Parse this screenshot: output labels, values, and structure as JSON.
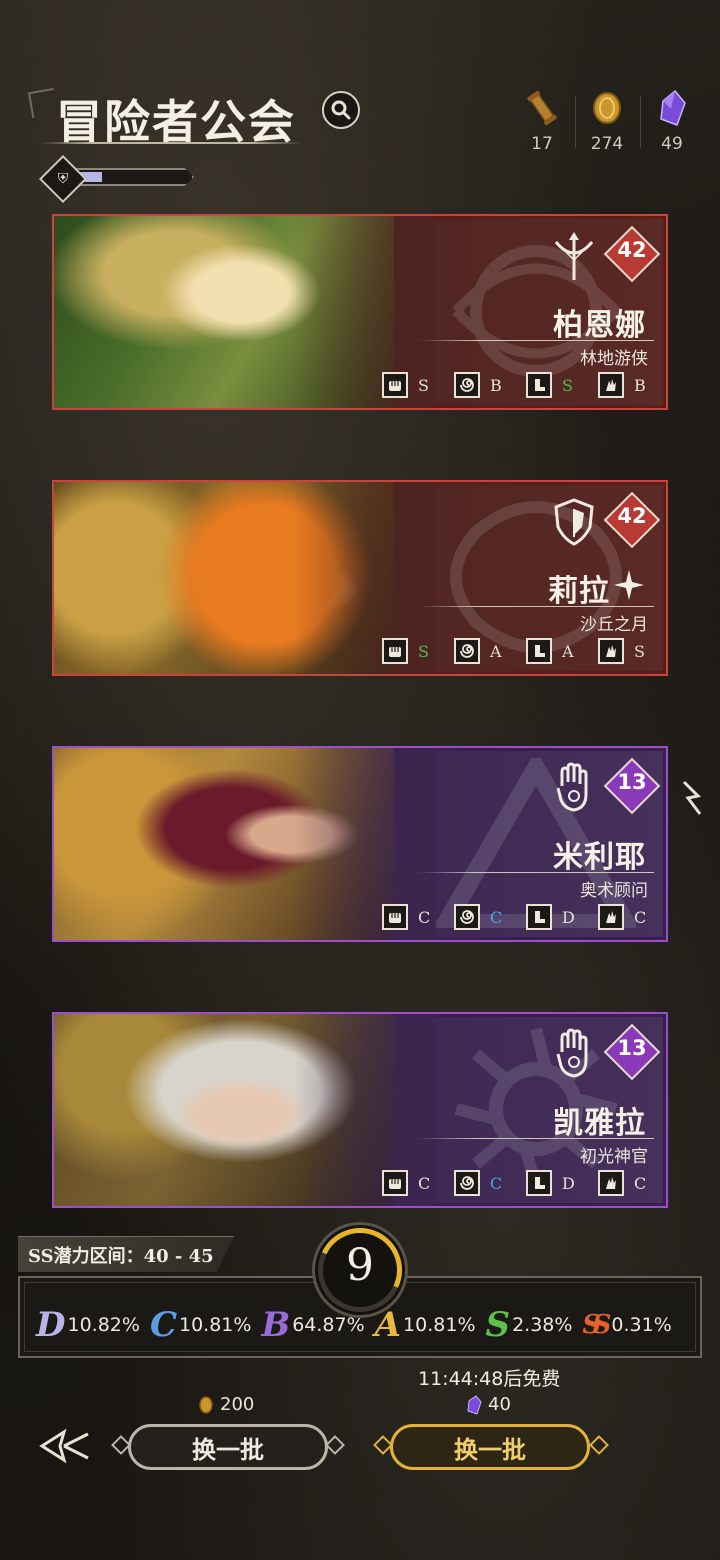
{
  "header": {
    "title": "冒险者公会",
    "level_progress": 0.2
  },
  "currencies": [
    {
      "icon": "scroll-icon",
      "value": "17"
    },
    {
      "icon": "gold-coin-icon",
      "value": "274"
    },
    {
      "icon": "purple-crystal-icon",
      "value": "49"
    }
  ],
  "cards": [
    {
      "name": "柏恩娜",
      "subtitle": "林地游侠",
      "level": "42",
      "rarity": "red",
      "class_icon": "bow-icon",
      "stats": [
        {
          "icon": "fist-icon",
          "grade": "S",
          "color": "#e8e2d4"
        },
        {
          "icon": "vortex-icon",
          "grade": "B",
          "color": "#e8e2d4"
        },
        {
          "icon": "boot-icon",
          "grade": "S",
          "color": "#4fc04a"
        },
        {
          "icon": "magic-hand-icon",
          "grade": "B",
          "color": "#e8e2d4"
        }
      ]
    },
    {
      "name": "莉拉",
      "subtitle": "沙丘之月",
      "level": "42",
      "rarity": "red",
      "class_icon": "shield-icon",
      "stats": [
        {
          "icon": "fist-icon",
          "grade": "S",
          "color": "#4fc04a"
        },
        {
          "icon": "vortex-icon",
          "grade": "A",
          "color": "#e8e2d4"
        },
        {
          "icon": "boot-icon",
          "grade": "A",
          "color": "#e8e2d4"
        },
        {
          "icon": "magic-hand-icon",
          "grade": "S",
          "color": "#e8e2d4"
        }
      ]
    },
    {
      "name": "米利耶",
      "subtitle": "奥术顾问",
      "level": "13",
      "rarity": "purple",
      "class_icon": "palm-icon",
      "stats": [
        {
          "icon": "fist-icon",
          "grade": "C",
          "color": "#e8e2d4"
        },
        {
          "icon": "vortex-icon",
          "grade": "C",
          "color": "#4aa6e0"
        },
        {
          "icon": "boot-icon",
          "grade": "D",
          "color": "#e8e2d4"
        },
        {
          "icon": "magic-hand-icon",
          "grade": "C",
          "color": "#e8e2d4"
        }
      ]
    },
    {
      "name": "凯雅拉",
      "subtitle": "初光神官",
      "level": "13",
      "rarity": "purple",
      "class_icon": "palm-icon",
      "stats": [
        {
          "icon": "fist-icon",
          "grade": "C",
          "color": "#e8e2d4"
        },
        {
          "icon": "vortex-icon",
          "grade": "C",
          "color": "#4aa6e0"
        },
        {
          "icon": "boot-icon",
          "grade": "D",
          "color": "#e8e2d4"
        },
        {
          "icon": "magic-hand-icon",
          "grade": "C",
          "color": "#e8e2d4"
        }
      ]
    }
  ],
  "potential": {
    "label": "SS潜力区间：40 - 45",
    "remaining": "9",
    "probabilities": [
      {
        "grade": "D",
        "value": "10.82%",
        "color": "#b9b4e8"
      },
      {
        "grade": "C",
        "value": "10.81%",
        "color": "#5b9ee8"
      },
      {
        "grade": "B",
        "value": "64.87%",
        "color": "#9a6ad8"
      },
      {
        "grade": "A",
        "value": "10.81%",
        "color": "#e8b840"
      },
      {
        "grade": "S",
        "value": "2.38%",
        "color": "#5cc04a"
      },
      {
        "grade": "SS",
        "value": "0.31%",
        "color": "#e8602e"
      }
    ]
  },
  "actions": {
    "timer": "11:44:48后免费",
    "left_cost": "200",
    "right_cost": "40",
    "left_label": "换一批",
    "right_label": "换一批"
  }
}
